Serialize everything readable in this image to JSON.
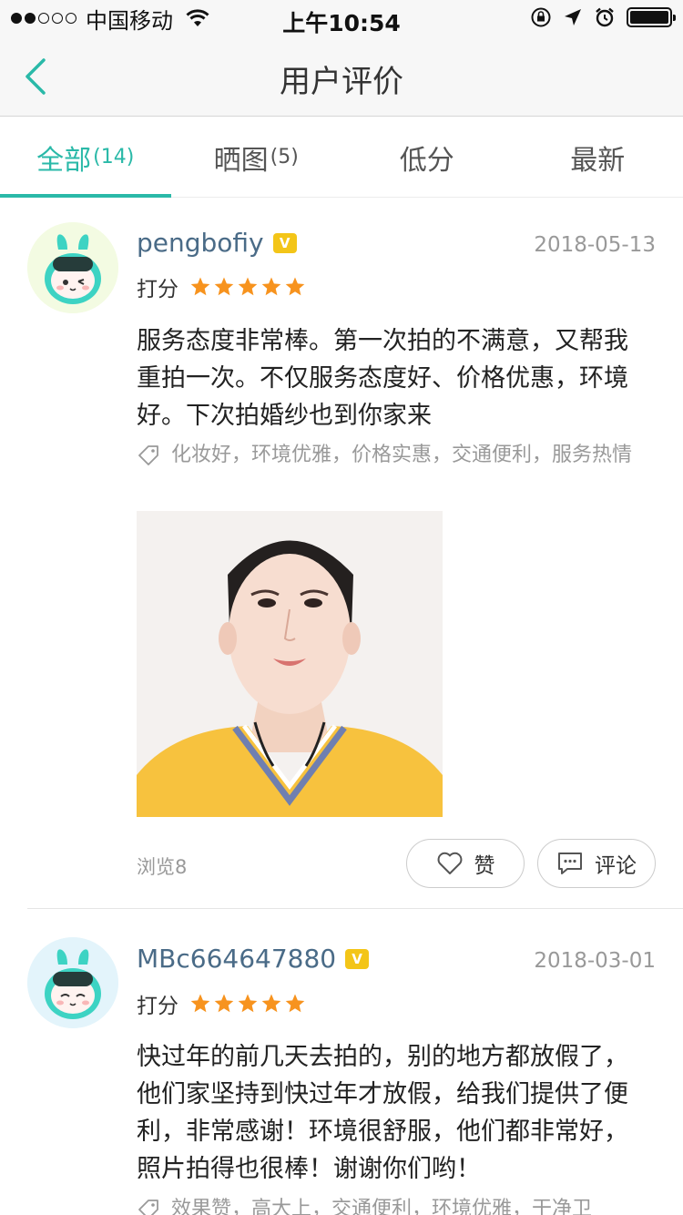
{
  "status_bar": {
    "carrier": "中国移动",
    "time": "上午10:54"
  },
  "nav": {
    "title": "用户评价"
  },
  "tabs": [
    {
      "label": "全部",
      "count": "(14)",
      "active": true
    },
    {
      "label": "晒图",
      "count": "(5)",
      "active": false
    },
    {
      "label": "低分",
      "count": "",
      "active": false
    },
    {
      "label": "最新",
      "count": "",
      "active": false
    }
  ],
  "reviews": [
    {
      "username": "pengbofiy",
      "vip_label": "V",
      "date": "2018-05-13",
      "rating_label": "打分",
      "rating": 5,
      "content": "服务态度非常棒。第一次拍的不满意，又帮我重拍一次。不仅服务态度好、价格优惠，环境好。下次拍婚纱也到你家来",
      "tags": "化妆好，环境优雅，价格实惠，交通便利，服务热情",
      "views": "浏览8",
      "like_label": "赞",
      "comment_label": "评论"
    },
    {
      "username": "MBc664647880",
      "vip_label": "V",
      "date": "2018-03-01",
      "rating_label": "打分",
      "rating": 5,
      "content": "快过年的前几天去拍的，别的地方都放假了，他们家坚持到快过年才放假，给我们提供了便利，非常感谢！环境很舒服，他们都非常好，照片拍得也很棒！谢谢你们哟！",
      "tags": "效果赞，高大上，交通便利，环境优雅，干净卫"
    }
  ],
  "colors": {
    "accent": "#2ab9a8",
    "star": "#f7931e",
    "username": "#4a6b87",
    "vip": "#f3c518"
  }
}
